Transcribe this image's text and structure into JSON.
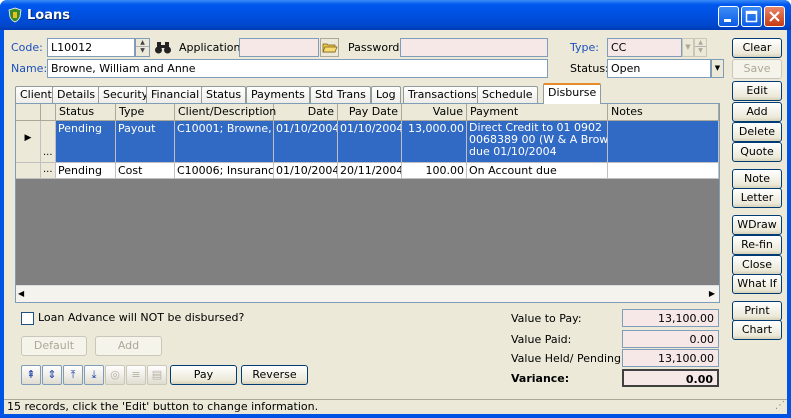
{
  "window": {
    "title": "Loans"
  },
  "header": {
    "code_label": "Code:",
    "code_value": "L10012",
    "application_label": "Application:",
    "application_value": "",
    "password_label": "Password:",
    "password_value": "",
    "type_label": "Type:",
    "type_value": "CC",
    "name_label": "Name:",
    "name_value": "Browne, William and Anne",
    "status_label": "Status:",
    "status_value": "Open"
  },
  "tabs": [
    "Client",
    "Details",
    "Security",
    "Financial",
    "Status",
    "Payments",
    "Std Trans",
    "Log",
    "Transactions",
    "Schedule",
    "Disburse"
  ],
  "active_tab": "Disburse",
  "grid": {
    "columns": [
      "Status",
      "Type",
      "Client/Description",
      "Date",
      "Pay Date",
      "Value",
      "Payment",
      "Notes"
    ],
    "rows": [
      {
        "indicator": "▶",
        "ellipsis": "...",
        "status": "Pending",
        "type": "Payout",
        "client": "C10001; Browne, ...",
        "date": "01/10/2004",
        "pay_date": "01/10/2004",
        "value": "13,000.00",
        "payment_line1": "Direct Credit to 01 0902",
        "payment_line2": "0068389 00 (W & A Browne)",
        "payment_line3": "due 01/10/2004",
        "notes": ""
      },
      {
        "indicator": "",
        "ellipsis": "...",
        "status": "Pending",
        "type": "Cost",
        "client": "C10006; Insuranc...",
        "date": "01/10/2004",
        "pay_date": "20/11/2004",
        "value": "100.00",
        "payment_line1": "On Account due",
        "notes": ""
      }
    ]
  },
  "bottom": {
    "checkbox_label": "Loan Advance will NOT be disbursed?",
    "checkbox_checked": false,
    "default_button": "Default",
    "add_button": "Add",
    "pay_button": "Pay",
    "reverse_button": "Reverse",
    "value_to_pay_label": "Value to Pay:",
    "value_to_pay": "13,100.00",
    "value_paid_label": "Value Paid:",
    "value_paid": "0.00",
    "value_held_label": "Value Held/ Pending:",
    "value_held": "13,100.00",
    "variance_label": "Variance:",
    "variance": "0.00"
  },
  "side_buttons": [
    "Clear",
    "Save",
    "Edit",
    "Add",
    "Delete",
    "Quote",
    "Note",
    "Letter",
    "WDraw",
    "Re-fin",
    "Close",
    "What If",
    "Print",
    "Chart"
  ],
  "statusbar": {
    "text": "15 records, click the 'Edit' button to change information."
  },
  "colors": {
    "title_bar": "#0054e3",
    "selection": "#316ac5",
    "label_blue": "#1c4fbe",
    "readonly_field": "#f7e8e8"
  }
}
